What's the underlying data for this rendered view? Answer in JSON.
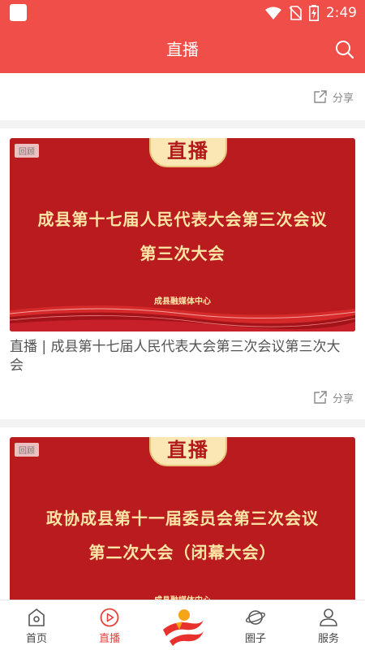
{
  "status_bar": {
    "time": "2:49"
  },
  "header": {
    "title": "直播"
  },
  "share_label": "分享",
  "cards": [
    {
      "badge": "直播",
      "replay_tag": "回顾",
      "banner_line1": "成县第十七届人民代表大会第三次会议",
      "banner_line2": "第三次大会",
      "org": "成县融媒体中心",
      "caption": "直播 | 成县第十七届人民代表大会第三次会议第三次大会"
    },
    {
      "badge": "直播",
      "replay_tag": "回顾",
      "banner_line1": "政协成县第十一届委员会第三次会议",
      "banner_line2": "第二次大会（闭幕大会）",
      "org": "成县融媒体中心"
    }
  ],
  "nav": [
    {
      "label": "首页",
      "icon": "home-icon",
      "active": false
    },
    {
      "label": "直播",
      "icon": "play-icon",
      "active": true
    },
    {
      "label": "",
      "icon": "app-logo",
      "active": false
    },
    {
      "label": "圈子",
      "icon": "planet-icon",
      "active": false
    },
    {
      "label": "服务",
      "icon": "user-icon",
      "active": false
    }
  ],
  "colors": {
    "brand": "#f04e48",
    "banner": "#b91b1f",
    "active": "#e8403c"
  }
}
